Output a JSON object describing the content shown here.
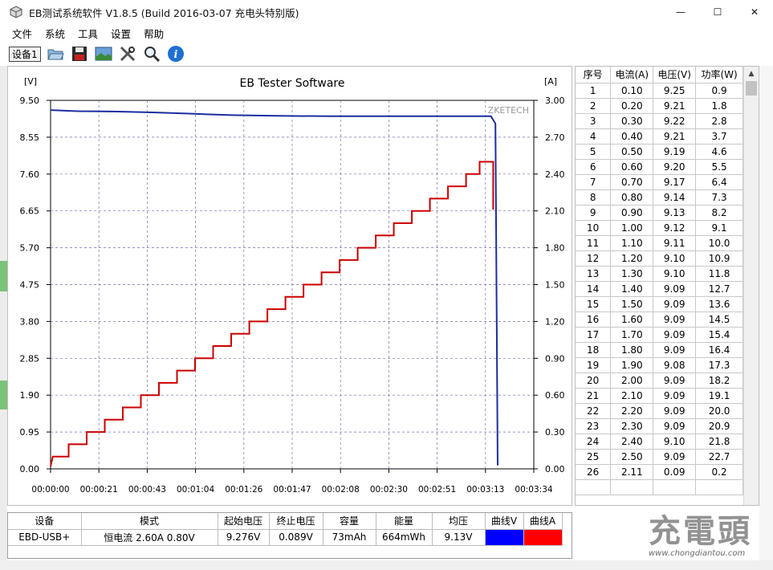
{
  "window": {
    "title": "EB测试系统软件 V1.8.5 (Build 2016-03-07 充电头特别版)",
    "minimize": "—",
    "maximize": "☐",
    "close": "✕"
  },
  "menu": [
    "文件",
    "系统",
    "工具",
    "设置",
    "帮助"
  ],
  "toolbar": {
    "device_tab": "设备1",
    "icons": [
      "open-folder-icon",
      "save-disk-icon",
      "image-icon",
      "tools-icon",
      "zoom-icon",
      "info-icon"
    ]
  },
  "chart_data": {
    "type": "line",
    "title": "EB Tester Software",
    "watermark": "ZKETECH",
    "y_left_unit": "[V]",
    "y_right_unit": "[A]",
    "y_left_ticks": [
      "9.50",
      "8.55",
      "7.60",
      "6.65",
      "5.70",
      "4.75",
      "3.80",
      "2.85",
      "1.90",
      "0.95",
      "0.00"
    ],
    "y_right_ticks": [
      "3.00",
      "2.70",
      "2.40",
      "2.10",
      "1.80",
      "1.50",
      "1.20",
      "0.90",
      "0.60",
      "0.30",
      "0.00"
    ],
    "x_ticks": [
      "00:00:00",
      "00:00:21",
      "00:00:43",
      "00:01:04",
      "00:01:26",
      "00:01:47",
      "00:02:08",
      "00:02:30",
      "00:02:51",
      "00:03:13",
      "00:03:34"
    ],
    "ylim_left": [
      0,
      9.5
    ],
    "ylim_right": [
      0,
      3.0
    ],
    "xlim_seconds": [
      0,
      214
    ],
    "grid": true,
    "series": [
      {
        "name": "曲线V",
        "color": "#1a2ea0",
        "axis": "left",
        "points": [
          [
            0,
            9.25
          ],
          [
            12,
            9.22
          ],
          [
            30,
            9.21
          ],
          [
            45,
            9.19
          ],
          [
            60,
            9.16
          ],
          [
            80,
            9.12
          ],
          [
            100,
            9.1
          ],
          [
            125,
            9.09
          ],
          [
            150,
            9.09
          ],
          [
            175,
            9.09
          ],
          [
            195,
            9.09
          ],
          [
            197,
            8.9
          ],
          [
            198,
            0.09
          ]
        ]
      },
      {
        "name": "曲线A",
        "color": "#cc0000",
        "axis": "right",
        "points": [
          [
            0,
            0.02
          ],
          [
            1,
            0.1
          ],
          [
            8,
            0.1
          ],
          [
            8,
            0.2
          ],
          [
            16,
            0.2
          ],
          [
            16,
            0.3
          ],
          [
            24,
            0.3
          ],
          [
            24,
            0.4
          ],
          [
            32,
            0.4
          ],
          [
            32,
            0.5
          ],
          [
            40,
            0.5
          ],
          [
            40,
            0.6
          ],
          [
            48,
            0.6
          ],
          [
            48,
            0.7
          ],
          [
            56,
            0.7
          ],
          [
            56,
            0.8
          ],
          [
            64,
            0.8
          ],
          [
            64,
            0.9
          ],
          [
            72,
            0.9
          ],
          [
            72,
            1.0
          ],
          [
            80,
            1.0
          ],
          [
            80,
            1.1
          ],
          [
            88,
            1.1
          ],
          [
            88,
            1.2
          ],
          [
            96,
            1.2
          ],
          [
            96,
            1.3
          ],
          [
            104,
            1.3
          ],
          [
            104,
            1.4
          ],
          [
            112,
            1.4
          ],
          [
            112,
            1.5
          ],
          [
            120,
            1.5
          ],
          [
            120,
            1.6
          ],
          [
            128,
            1.6
          ],
          [
            128,
            1.7
          ],
          [
            136,
            1.7
          ],
          [
            136,
            1.8
          ],
          [
            144,
            1.8
          ],
          [
            144,
            1.9
          ],
          [
            152,
            1.9
          ],
          [
            152,
            2.0
          ],
          [
            160,
            2.0
          ],
          [
            160,
            2.1
          ],
          [
            168,
            2.1
          ],
          [
            168,
            2.2
          ],
          [
            176,
            2.2
          ],
          [
            176,
            2.3
          ],
          [
            184,
            2.3
          ],
          [
            184,
            2.4
          ],
          [
            190,
            2.4
          ],
          [
            190,
            2.5
          ],
          [
            196,
            2.5
          ],
          [
            196,
            2.11
          ]
        ]
      }
    ]
  },
  "records": {
    "headers": [
      "序号",
      "电流(A)",
      "电压(V)",
      "功率(W)"
    ],
    "rows": [
      [
        "1",
        "0.10",
        "9.25",
        "0.9"
      ],
      [
        "2",
        "0.20",
        "9.21",
        "1.8"
      ],
      [
        "3",
        "0.30",
        "9.22",
        "2.8"
      ],
      [
        "4",
        "0.40",
        "9.21",
        "3.7"
      ],
      [
        "5",
        "0.50",
        "9.19",
        "4.6"
      ],
      [
        "6",
        "0.60",
        "9.20",
        "5.5"
      ],
      [
        "7",
        "0.70",
        "9.17",
        "6.4"
      ],
      [
        "8",
        "0.80",
        "9.14",
        "7.3"
      ],
      [
        "9",
        "0.90",
        "9.13",
        "8.2"
      ],
      [
        "10",
        "1.00",
        "9.12",
        "9.1"
      ],
      [
        "11",
        "1.10",
        "9.11",
        "10.0"
      ],
      [
        "12",
        "1.20",
        "9.10",
        "10.9"
      ],
      [
        "13",
        "1.30",
        "9.10",
        "11.8"
      ],
      [
        "14",
        "1.40",
        "9.09",
        "12.7"
      ],
      [
        "15",
        "1.50",
        "9.09",
        "13.6"
      ],
      [
        "16",
        "1.60",
        "9.09",
        "14.5"
      ],
      [
        "17",
        "1.70",
        "9.09",
        "15.4"
      ],
      [
        "18",
        "1.80",
        "9.09",
        "16.4"
      ],
      [
        "19",
        "1.90",
        "9.08",
        "17.3"
      ],
      [
        "20",
        "2.00",
        "9.09",
        "18.2"
      ],
      [
        "21",
        "2.10",
        "9.09",
        "19.1"
      ],
      [
        "22",
        "2.20",
        "9.09",
        "20.0"
      ],
      [
        "23",
        "2.30",
        "9.09",
        "20.9"
      ],
      [
        "24",
        "2.40",
        "9.10",
        "21.8"
      ],
      [
        "25",
        "2.50",
        "9.09",
        "22.7"
      ],
      [
        "26",
        "2.11",
        "0.09",
        "0.2"
      ]
    ]
  },
  "summary": {
    "headers": [
      "设备",
      "模式",
      "起始电压",
      "终止电压",
      "容量",
      "能量",
      "均压",
      "曲线V",
      "曲线A"
    ],
    "values": [
      "EBD-USB+",
      "恒电流 2.60A 0.80V",
      "9.276V",
      "0.089V",
      "73mAh",
      "664mWh",
      "9.13V"
    ],
    "curve_v_color": "#0000ff",
    "curve_a_color": "#ff0000"
  },
  "watermark": {
    "big": "充電頭",
    "small": "www.chongdiantou.com"
  }
}
